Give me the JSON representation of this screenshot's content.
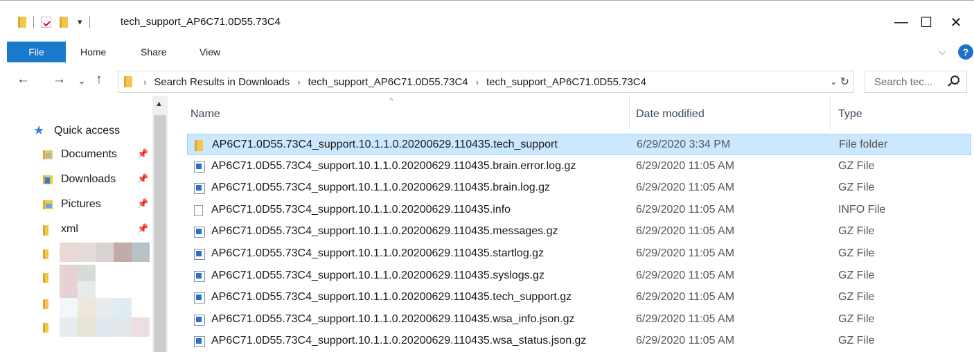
{
  "window": {
    "title": "tech_support_AP6C71.0D55.73C4",
    "qa_dropdown_glyph": "▾",
    "minimize_glyph": "—",
    "maximize_glyph": "☐",
    "close_glyph": "✕"
  },
  "ribbon": {
    "tabs": [
      "File",
      "Home",
      "Share",
      "View"
    ],
    "expand_glyph": "⌵",
    "help_glyph": "?"
  },
  "nav": {
    "back_glyph": "←",
    "forward_glyph": "→",
    "recent_glyph": "⌄",
    "up_glyph": "↑"
  },
  "address": {
    "crumbs": [
      "Search Results in Downloads",
      "tech_support_AP6C71.0D55.73C4",
      "tech_support_AP6C71.0D55.73C4"
    ],
    "sep_glyph": "›",
    "dropdown_glyph": "⌄",
    "refresh_glyph": "↻"
  },
  "search": {
    "placeholder": "Search tec..."
  },
  "sidebar": {
    "quick_access": "Quick access",
    "items": [
      {
        "label": "Documents",
        "icon": "documents-folder-icon"
      },
      {
        "label": "Downloads",
        "icon": "downloads-folder-icon"
      },
      {
        "label": "Pictures",
        "icon": "pictures-folder-icon"
      },
      {
        "label": "xml",
        "icon": "folder-icon"
      }
    ],
    "pin_glyph": "📌",
    "scroll_up_glyph": "▲"
  },
  "columns": {
    "name": "Name",
    "date": "Date modified",
    "type": "Type",
    "sort_glyph": "^"
  },
  "files": [
    {
      "name": "AP6C71.0D55.73C4_support.10.1.1.0.20200629.110435.tech_support",
      "date": "6/29/2020 3:34 PM",
      "type": "File folder",
      "icon": "folder",
      "selected": true
    },
    {
      "name": "AP6C71.0D55.73C4_support.10.1.1.0.20200629.110435.brain.error.log.gz",
      "date": "6/29/2020 11:05 AM",
      "type": "GZ File",
      "icon": "gz"
    },
    {
      "name": "AP6C71.0D55.73C4_support.10.1.1.0.20200629.110435.brain.log.gz",
      "date": "6/29/2020 11:05 AM",
      "type": "GZ File",
      "icon": "gz"
    },
    {
      "name": "AP6C71.0D55.73C4_support.10.1.1.0.20200629.110435.info",
      "date": "6/29/2020 11:05 AM",
      "type": "INFO File",
      "icon": "file"
    },
    {
      "name": "AP6C71.0D55.73C4_support.10.1.1.0.20200629.110435.messages.gz",
      "date": "6/29/2020 11:05 AM",
      "type": "GZ File",
      "icon": "gz"
    },
    {
      "name": "AP6C71.0D55.73C4_support.10.1.1.0.20200629.110435.startlog.gz",
      "date": "6/29/2020 11:05 AM",
      "type": "GZ File",
      "icon": "gz"
    },
    {
      "name": "AP6C71.0D55.73C4_support.10.1.1.0.20200629.110435.syslogs.gz",
      "date": "6/29/2020 11:05 AM",
      "type": "GZ File",
      "icon": "gz"
    },
    {
      "name": "AP6C71.0D55.73C4_support.10.1.1.0.20200629.110435.tech_support.gz",
      "date": "6/29/2020 11:05 AM",
      "type": "GZ File",
      "icon": "gz"
    },
    {
      "name": "AP6C71.0D55.73C4_support.10.1.1.0.20200629.110435.wsa_info.json.gz",
      "date": "6/29/2020 11:05 AM",
      "type": "GZ File",
      "icon": "gz"
    },
    {
      "name": "AP6C71.0D55.73C4_support.10.1.1.0.20200629.110435.wsa_status.json.gz",
      "date": "6/29/2020 11:05 AM",
      "type": "GZ File",
      "icon": "gz"
    }
  ]
}
